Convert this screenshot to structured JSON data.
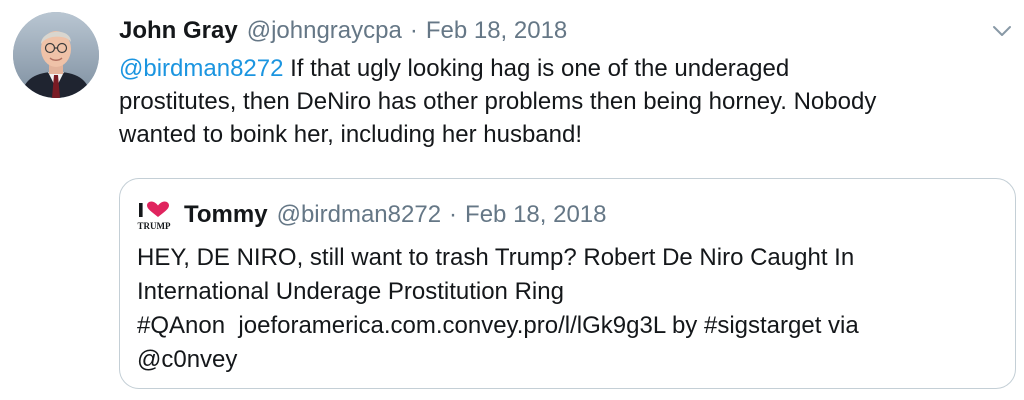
{
  "tweet": {
    "author": {
      "display_name": "John Gray",
      "handle": "@johngraycpa",
      "avatar_icon": "profile-photo"
    },
    "separator": "·",
    "date": "Feb 18, 2018",
    "more_icon": "chevron-down-icon",
    "body": {
      "mention": "@birdman8272",
      "text_line1": " If that ugly looking hag is one of the underaged",
      "text_line2": "prostitutes, then DeNiro has other problems then being horney. Nobody",
      "text_line3": "wanted to boink her, including her husband!"
    }
  },
  "quoted_tweet": {
    "author": {
      "display_name": "Tommy",
      "handle": "@birdman8272",
      "avatar_icon": "i-love-trump-icon",
      "avatar_text": "TRUMP"
    },
    "separator": "·",
    "date": "Feb 18, 2018",
    "lines": {
      "line1": "HEY, DE NIRO, still want to trash Trump? Robert De Niro Caught In",
      "line2": "International Underage Prostitution Ring",
      "hashtag": "#QAnon",
      "link": "joeforamerica.com.convey.pro/l/lGk9g3L",
      "by_text": " by ",
      "hashtag2": "#sigstarget",
      "via_text": " via",
      "mention": "@c0nvey"
    }
  },
  "colors": {
    "text": "#14171a",
    "secondary": "#657786",
    "link": "#1b95e0",
    "border": "#c4cfd6",
    "heart": "#e0245e"
  }
}
